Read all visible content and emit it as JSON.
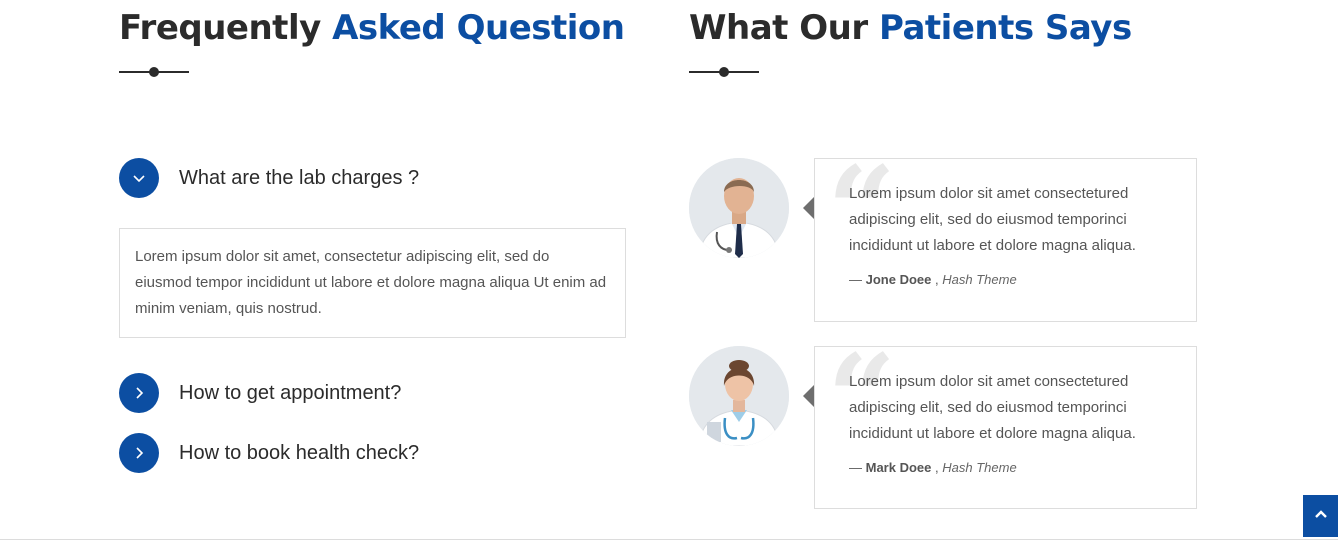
{
  "faq": {
    "heading_plain": "Frequently",
    "heading_accent": "Asked Question",
    "items": [
      {
        "question": "What are the lab charges ?",
        "expanded": true,
        "answer": "Lorem ipsum dolor sit amet, consectetur adipiscing elit, sed do eiusmod tempor incididunt ut labore et dolore magna aliqua Ut enim ad minim veniam, quis nostrud."
      },
      {
        "question": "How to get appointment?",
        "expanded": false
      },
      {
        "question": "How to book health check?",
        "expanded": false
      }
    ]
  },
  "testimonials": {
    "heading_plain": "What Our",
    "heading_accent": "Patients Says",
    "items": [
      {
        "text": "Lorem ipsum dolor sit amet consectetured adipiscing elit, sed do eiusmod temporinci incididunt ut labore et dolore magna aliqua.",
        "dash": "—",
        "name": "Jone Doee",
        "separator": ",",
        "org": "Hash Theme",
        "avatar": "male-doctor-avatar"
      },
      {
        "text": "Lorem ipsum dolor sit amet consectetured adipiscing elit, sed do eiusmod temporinci incididunt ut labore et dolore magna aliqua.",
        "dash": "—",
        "name": "Mark Doee",
        "separator": ",",
        "org": "Hash Theme",
        "avatar": "female-doctor-avatar"
      }
    ]
  },
  "colors": {
    "accent": "#0c4ea2",
    "heading": "#2b2b2b",
    "body_text": "#555555",
    "border": "#dddddd"
  },
  "icons": {
    "expanded_toggle": "chevron-down-icon",
    "collapsed_toggle": "chevron-right-icon",
    "scroll_top": "chevron-up-icon",
    "quote": "quote-icon"
  }
}
